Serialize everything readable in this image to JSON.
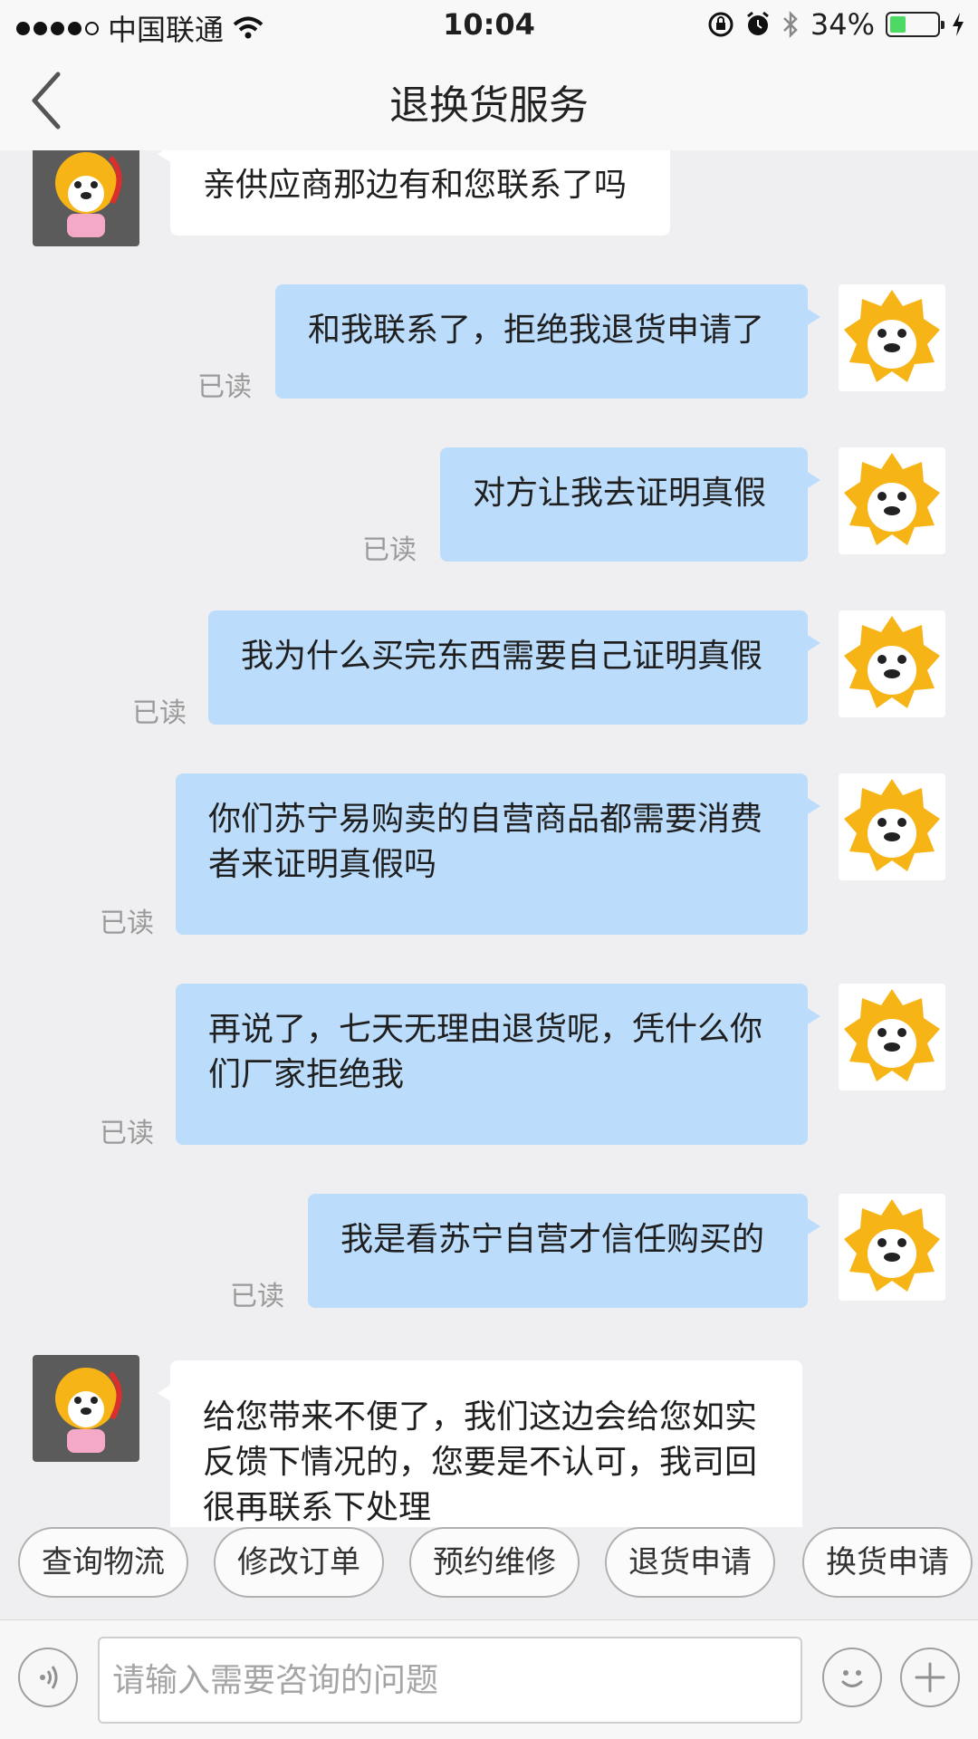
{
  "status_bar": {
    "carrier": "中国联通",
    "time": "10:04",
    "battery": "34%",
    "battery_level": 0.34,
    "accent": "#4cd964"
  },
  "header": {
    "title": "退换货服务"
  },
  "messages": [
    {
      "sender": "agent",
      "text": "亲供应商那边有和您联系了吗"
    },
    {
      "sender": "user",
      "text": "和我联系了，拒绝我退货申请了",
      "status": "已读"
    },
    {
      "sender": "user",
      "text": "对方让我去证明真假",
      "status": "已读"
    },
    {
      "sender": "user",
      "text": "我为什么买完东西需要自己证明真假",
      "status": "已读"
    },
    {
      "sender": "user",
      "text": "你们苏宁易购卖的自营商品都需要消费者来证明真假吗",
      "status": "已读"
    },
    {
      "sender": "user",
      "text": "再说了，七天无理由退货呢，凭什么你们厂家拒绝我",
      "status": "已读"
    },
    {
      "sender": "user",
      "text": "我是看苏宁自营才信任购买的",
      "status": "已读"
    },
    {
      "sender": "agent",
      "text": "给您带来不便了，我们这边会给您如实反馈下情况的，您要是不认可，我司回很再联系下处理"
    }
  ],
  "quick_actions": [
    "查询物流",
    "修改订单",
    "预约维修",
    "退货申请",
    "换货申请"
  ],
  "input": {
    "placeholder": "请输入需要咨询的问题"
  },
  "colors": {
    "user_bubble": "#bcdcfb",
    "agent_bubble": "#ffffff",
    "brand_yellow": "#f7b417"
  }
}
